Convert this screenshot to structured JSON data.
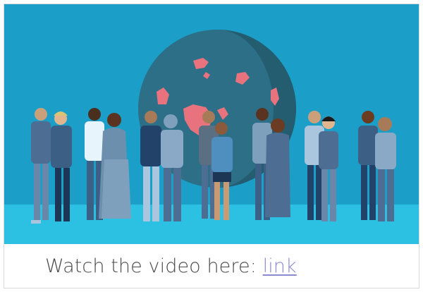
{
  "caption": {
    "text": "Watch the video here:",
    "link_label": "link"
  },
  "colors": {
    "sky": "#1b9fc9",
    "ground": "#2cc0e2",
    "globe": "#2c6f86",
    "land_highlight": "#e8737f",
    "link": "#8a8ad0"
  },
  "illustration": {
    "subject": "globe-with-diverse-group-of-people",
    "people_count": 17
  }
}
